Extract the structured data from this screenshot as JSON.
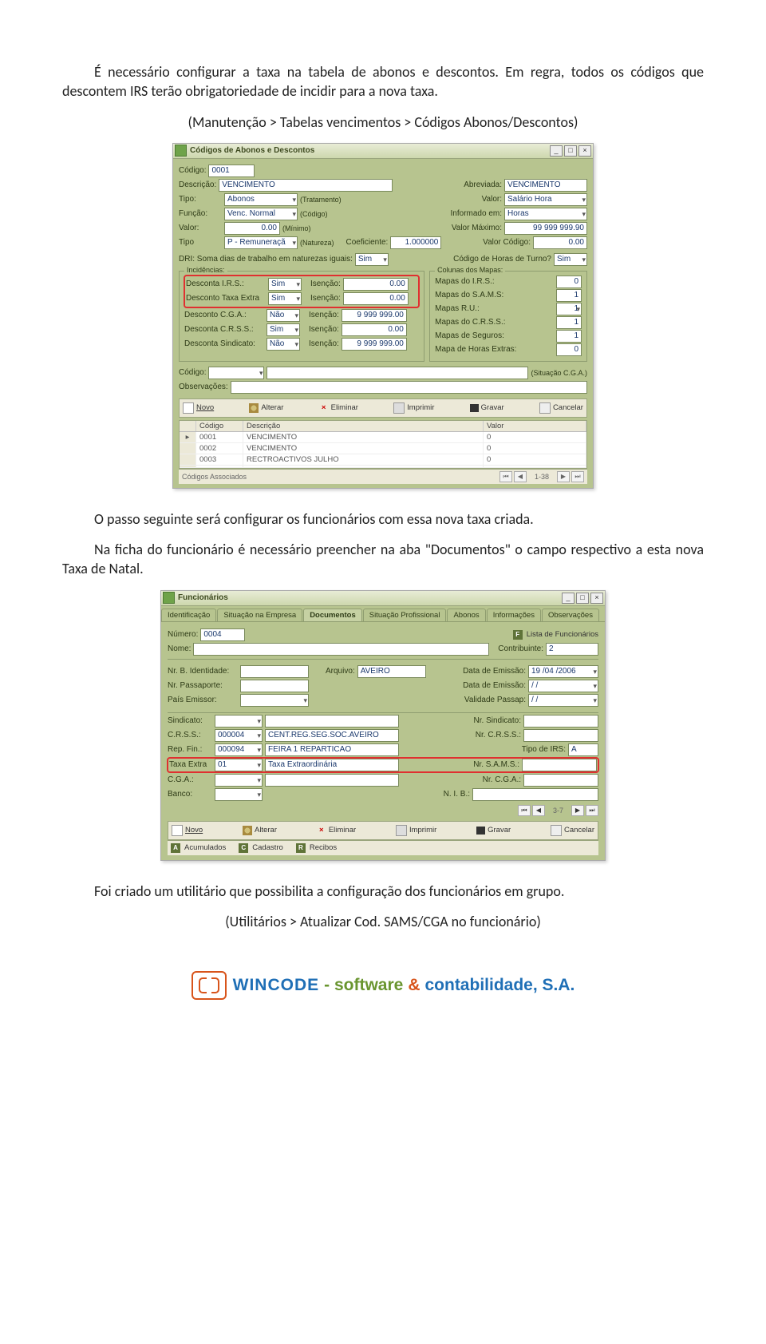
{
  "para1": "É necessário configurar a taxa na tabela de abonos e descontos. Em regra, todos os códigos que descontem IRS terão obrigatoriedade de incidir para a nova taxa.",
  "path1": "(Manutenção > Tabelas vencimentos > Códigos Abonos/Descontos)",
  "para2": "O passo seguinte será configurar os funcionários com essa nova taxa criada.",
  "para3": "Na ficha do funcionário é necessário preencher na aba \"Documentos\" o campo respectivo a esta nova Taxa de Natal.",
  "para4": "Foi criado um utilitário que possibilita a configuração dos funcionários em grupo.",
  "path2": "(Utilitários > Atualizar Cod. SAMS/CGA no funcionário)",
  "footer": {
    "w1": "WINCODE",
    "w2": "- software",
    "amp": "&",
    "w3": "contabilidade, S.A."
  },
  "win1": {
    "title": "Códigos de Abonos e Descontos",
    "codigo": {
      "l": "Código:",
      "v": "0001"
    },
    "descricao": {
      "l": "Descrição:",
      "v": "VENCIMENTO"
    },
    "abreviada": {
      "l": "Abreviada:",
      "v": "VENCIMENTO"
    },
    "tipo": {
      "l": "Tipo:",
      "v": "Abonos",
      "n": "(Tratamento)"
    },
    "valor1": {
      "l": "Valor:",
      "v": "Salário Hora"
    },
    "funcao": {
      "l": "Função:",
      "v": "Venc. Normal",
      "n": "(Código)"
    },
    "informado": {
      "l": "Informado em:",
      "v": "Horas"
    },
    "valor2": {
      "l": "Valor:",
      "v": "0.00",
      "n": "(Mínimo)"
    },
    "vmax": {
      "l": "Valor Máximo:",
      "v": "99 999 999.90"
    },
    "coef": {
      "l": "Coeficiente:",
      "v": "1.000000"
    },
    "tipo2": {
      "l": "Tipo",
      "v": "P - Remuneraçã",
      "n": "(Natureza)"
    },
    "vcod": {
      "l": "Valor Código:",
      "v": "0.00"
    },
    "dri": {
      "l": "DRI: Soma dias de trabalho em naturezas iguais:",
      "v": "Sim"
    },
    "horasturno": {
      "l": "Código de Horas de Turno?",
      "v": "Sim"
    },
    "incid_title": "Incidências:",
    "irs": {
      "l": "Desconta I.R.S.:",
      "v": "Sim",
      "il": "Isenção:",
      "iv": "0.00"
    },
    "taxa": {
      "l": "Desconto Taxa Extra",
      "v": "Sim",
      "il": "Isenção:",
      "iv": "0.00"
    },
    "cga": {
      "l": "Desconto C.G.A.:",
      "v": "Não",
      "il": "Isenção:",
      "iv": "9 999 999.00"
    },
    "crss": {
      "l": "Desconta C.R.S.S.:",
      "v": "Sim",
      "il": "Isenção:",
      "iv": "0.00"
    },
    "sind": {
      "l": "Desconta Sindicato:",
      "v": "Não",
      "il": "Isenção:",
      "iv": "9 999 999.00"
    },
    "mapas_title": "Colunas dos Mapas:",
    "mapas": [
      {
        "l": "Mapas do I.R.S.:",
        "v": "0"
      },
      {
        "l": "Mapas do S.A.M.S:",
        "v": "1"
      },
      {
        "l": "Mapas R.U.:",
        "v": "1"
      },
      {
        "l": "Mapas do C.R.S.S.:",
        "v": "1"
      },
      {
        "l": "Mapas de Seguros:",
        "v": "1"
      },
      {
        "l": "Mapa de Horas Extras:",
        "v": "0"
      }
    ],
    "codigo2": {
      "l": "Código:",
      "sit": "(Situação C.G.A.)"
    },
    "obs": {
      "l": "Observações:"
    },
    "tb": {
      "novo": "Novo",
      "alterar": "Alterar",
      "eliminar": "Eliminar",
      "imprimir": "Imprimir",
      "gravar": "Gravar",
      "cancelar": "Cancelar"
    },
    "gridh": {
      "c": "Código",
      "d": "Descrição",
      "v": "Valor"
    },
    "gridr": [
      {
        "c": "0001",
        "d": "VENCIMENTO",
        "v": "0"
      },
      {
        "c": "0002",
        "d": "VENCIMENTO",
        "v": "0"
      },
      {
        "c": "0003",
        "d": "RECTROACTIVOS JULHO",
        "v": "0"
      }
    ],
    "status": "Códigos Associados",
    "page": "1-38"
  },
  "win2": {
    "title": "Funcionários",
    "tabs": [
      "Identificação",
      "Situação na Empresa",
      "Documentos",
      "Situação Profissional",
      "Abonos",
      "Informações",
      "Observações"
    ],
    "numero": {
      "l": "Número:",
      "v": "0004"
    },
    "listaf": "Lista de Funcionários",
    "nome": {
      "l": "Nome:"
    },
    "contrib": {
      "l": "Contribuinte:",
      "v": "2"
    },
    "bi": {
      "l": "Nr. B. Identidade:"
    },
    "arq": {
      "l": "Arquivo:",
      "v": "AVEIRO"
    },
    "de1": {
      "l": "Data de Emissão:",
      "v": "19 /04 /2006"
    },
    "pass": {
      "l": "Nr. Passaporte:"
    },
    "de2": {
      "l": "Data de Emissão:",
      "v": "  /    /"
    },
    "pemiss": {
      "l": "País Emissor:"
    },
    "vpass": {
      "l": "Validade Passap:",
      "v": "  /    /"
    },
    "sindic": {
      "l": "Sindicato:"
    },
    "nsind": {
      "l": "Nr. Sindicato:"
    },
    "crss": {
      "l": "C.R.S.S.:",
      "v": "000004",
      "d": "CENT.REG.SEG.SOC.AVEIRO"
    },
    "ncrss": {
      "l": "Nr. C.R.S.S.:"
    },
    "repfin": {
      "l": "Rep. Fin.:",
      "v": "000094",
      "d": "FEIRA 1 REPARTICAO"
    },
    "tipoirs": {
      "l": "Tipo de IRS:",
      "v": "A"
    },
    "taxaex": {
      "l": "Taxa Extra",
      "v": "01",
      "d": "Taxa Extraordinária"
    },
    "nsams": {
      "l": "Nr. S.A.M.S.:"
    },
    "cga": {
      "l": "C.G.A.:"
    },
    "ncga": {
      "l": "Nr. C.G.A.:"
    },
    "banco": {
      "l": "Banco:"
    },
    "nib": {
      "l": "N. I. B.:"
    },
    "page": "3-7",
    "tb": {
      "novo": "Novo",
      "alterar": "Alterar",
      "eliminar": "Eliminar",
      "imprimir": "Imprimir",
      "gravar": "Gravar",
      "cancelar": "Cancelar"
    },
    "leg": [
      {
        "k": "A",
        "t": "Acumulados"
      },
      {
        "k": "C",
        "t": "Cadastro"
      },
      {
        "k": "R",
        "t": "Recibos"
      }
    ]
  }
}
